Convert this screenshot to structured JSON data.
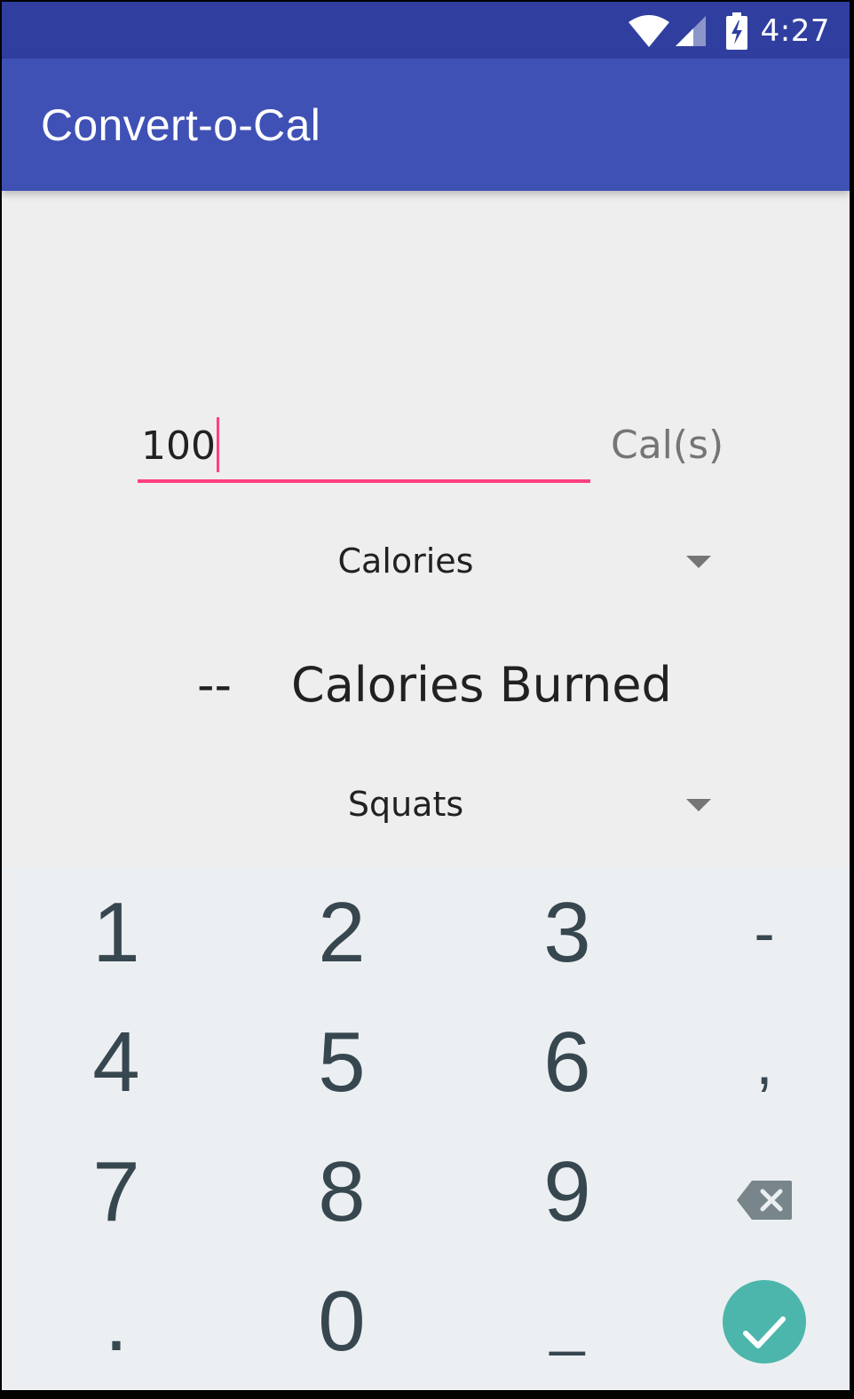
{
  "status_bar": {
    "time": "4:27",
    "icons": [
      "wifi-icon",
      "cell-signal-icon",
      "battery-charging-icon"
    ]
  },
  "app_bar": {
    "title": "Convert-o-Cal"
  },
  "form": {
    "amount_value": "100",
    "unit_label": "Cal(s)",
    "from_spinner": {
      "selected": "Calories"
    },
    "result_value": "--",
    "result_label": "Calories Burned",
    "to_spinner": {
      "selected": "Squats"
    }
  },
  "keypad": {
    "row1": [
      "1",
      "2",
      "3",
      "-"
    ],
    "row2": [
      "4",
      "5",
      "6",
      ","
    ],
    "row3": [
      "7",
      "8",
      "9",
      "backspace-icon"
    ],
    "row4": [
      ".",
      "0",
      "_",
      "done-check-icon"
    ]
  },
  "colors": {
    "status_bar": "#303f9f",
    "app_bar": "#3f51b5",
    "accent": "#ff4081",
    "keypad_bg": "#eceff1",
    "key_text": "#37474f",
    "done_button": "#4db6ac"
  }
}
